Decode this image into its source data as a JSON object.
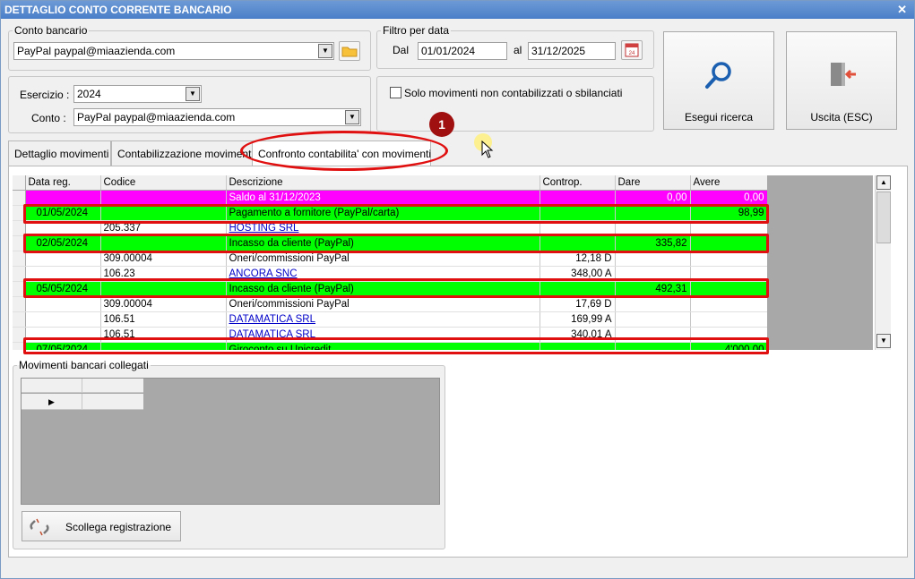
{
  "window": {
    "title": "DETTAGLIO CONTO CORRENTE BANCARIO",
    "close_glyph": "✕"
  },
  "conto_bancario": {
    "legend": "Conto bancario",
    "value": "PayPal paypal@miaazienda.com"
  },
  "filtro_data": {
    "legend": "Filtro per data",
    "dal_label": "Dal",
    "dal_value": "01/01/2024",
    "al_label": "al",
    "al_value": "31/12/2025",
    "calendar_day": "24"
  },
  "buttons": {
    "search_label": "Esegui ricerca",
    "exit_label": "Uscita (ESC)",
    "unlink_label": "Scollega registrazione"
  },
  "esercizio": {
    "label": "Esercizio :",
    "value": "2024",
    "conto_label": "Conto :",
    "conto_value": "PayPal paypal@miaazienda.com"
  },
  "options": {
    "solo_movimenti": "Solo movimenti non contabilizzati o sbilanciati"
  },
  "tabs": [
    {
      "label": "Dettaglio movimenti"
    },
    {
      "label": "Contabilizzazione movimenti"
    },
    {
      "label": "Confronto contabilita' con movimenti"
    }
  ],
  "grid": {
    "columns": [
      "Data reg.",
      "Codice",
      "Descrizione",
      "Controp.",
      "Dare",
      "Avere"
    ],
    "rows": [
      {
        "type": "magenta",
        "data": "",
        "codice": "",
        "descrizione": "Saldo al 31/12/2023",
        "controp": "",
        "dare": "0,00",
        "avere": "0,00"
      },
      {
        "type": "green",
        "data": "01/05/2024",
        "codice": "",
        "descrizione": "Pagamento a fornitore (PayPal/carta)",
        "controp": "",
        "dare": "",
        "avere": "98,99"
      },
      {
        "type": "sub",
        "data": "",
        "codice": "205.337",
        "descrizione": "HOSTING SRL",
        "controp": "",
        "dare": "",
        "avere": "",
        "link": true
      },
      {
        "type": "green",
        "data": "02/05/2024",
        "codice": "",
        "descrizione": "Incasso da cliente (PayPal)",
        "controp": "",
        "dare": "335,82",
        "avere": ""
      },
      {
        "type": "sub",
        "data": "",
        "codice": "309.00004",
        "descrizione": "Oneri/commissioni PayPal",
        "controp": "12,18 D",
        "dare": "",
        "avere": ""
      },
      {
        "type": "sub",
        "data": "",
        "codice": "106.23",
        "descrizione": "ANCORA SNC",
        "controp": "348,00 A",
        "dare": "",
        "avere": "",
        "link": true
      },
      {
        "type": "green",
        "data": "05/05/2024",
        "codice": "",
        "descrizione": "Incasso da cliente (PayPal)",
        "controp": "",
        "dare": "492,31",
        "avere": ""
      },
      {
        "type": "sub",
        "data": "",
        "codice": "309.00004",
        "descrizione": "Oneri/commissioni PayPal",
        "controp": "17,69 D",
        "dare": "",
        "avere": ""
      },
      {
        "type": "sub",
        "data": "",
        "codice": "106.51",
        "descrizione": "DATAMATICA SRL",
        "controp": "169,99 A",
        "dare": "",
        "avere": "",
        "link": true
      },
      {
        "type": "sub",
        "data": "",
        "codice": "106.51",
        "descrizione": "DATAMATICA SRL",
        "controp": "340,01 A",
        "dare": "",
        "avere": "",
        "link": true
      },
      {
        "type": "green",
        "data": "07/05/2024",
        "codice": "",
        "descrizione": "Giroconto su Unicredit",
        "controp": "",
        "dare": "",
        "avere": "4'000,00"
      }
    ]
  },
  "movimenti_collegati": {
    "legend": "Movimenti bancari collegati",
    "row_marker": "▶"
  },
  "annotation": {
    "number": "1"
  },
  "colors": {
    "magenta": "#ff00ff",
    "green": "#00ff00",
    "highlight": "#e01010",
    "link": "#0000c8"
  }
}
